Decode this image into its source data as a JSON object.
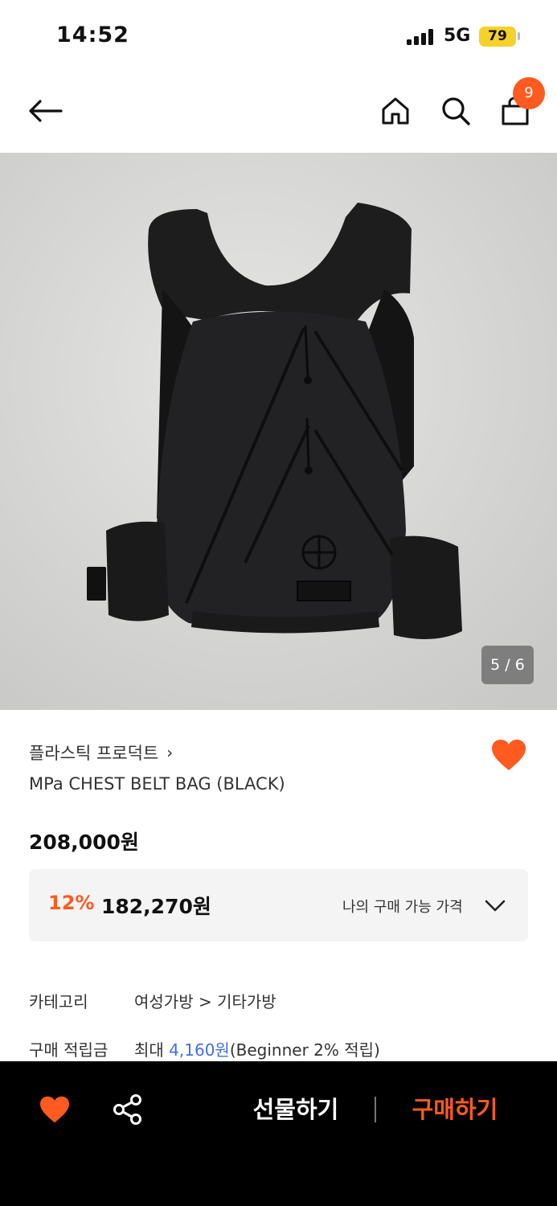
{
  "status_bar": {
    "time": "14:52",
    "network": "5G",
    "battery": "79"
  },
  "nav": {
    "cart_count": "9",
    "icons": [
      "back-arrow-icon",
      "home-icon",
      "search-icon",
      "shopping-bag-icon"
    ]
  },
  "product": {
    "image_counter": "5 / 6",
    "brand": "플라스틱 프로덕트",
    "brand_chevron": "›",
    "name": "MPa CHEST BELT BAG (BLACK)",
    "price": "208,000원",
    "liked": true
  },
  "discount": {
    "rate": "12%",
    "price": "182,270원",
    "my_price_label": "나의 구매 가능 가격"
  },
  "info": {
    "category_label": "카테고리",
    "category_value": "여성가방 > 기타가방",
    "points_label": "구매 적립금",
    "points_prefix": "최대 ",
    "points_amount": "4,160원",
    "points_suffix": "(Beginner 2% 적립)"
  },
  "bottom_bar": {
    "gift_label": "선물하기",
    "buy_label": "구매하기"
  },
  "colors": {
    "accent": "#ff5a1f",
    "link_blue": "#3f6ee8",
    "battery": "#f5d12a",
    "bottom_bar_bg": "#000000"
  }
}
